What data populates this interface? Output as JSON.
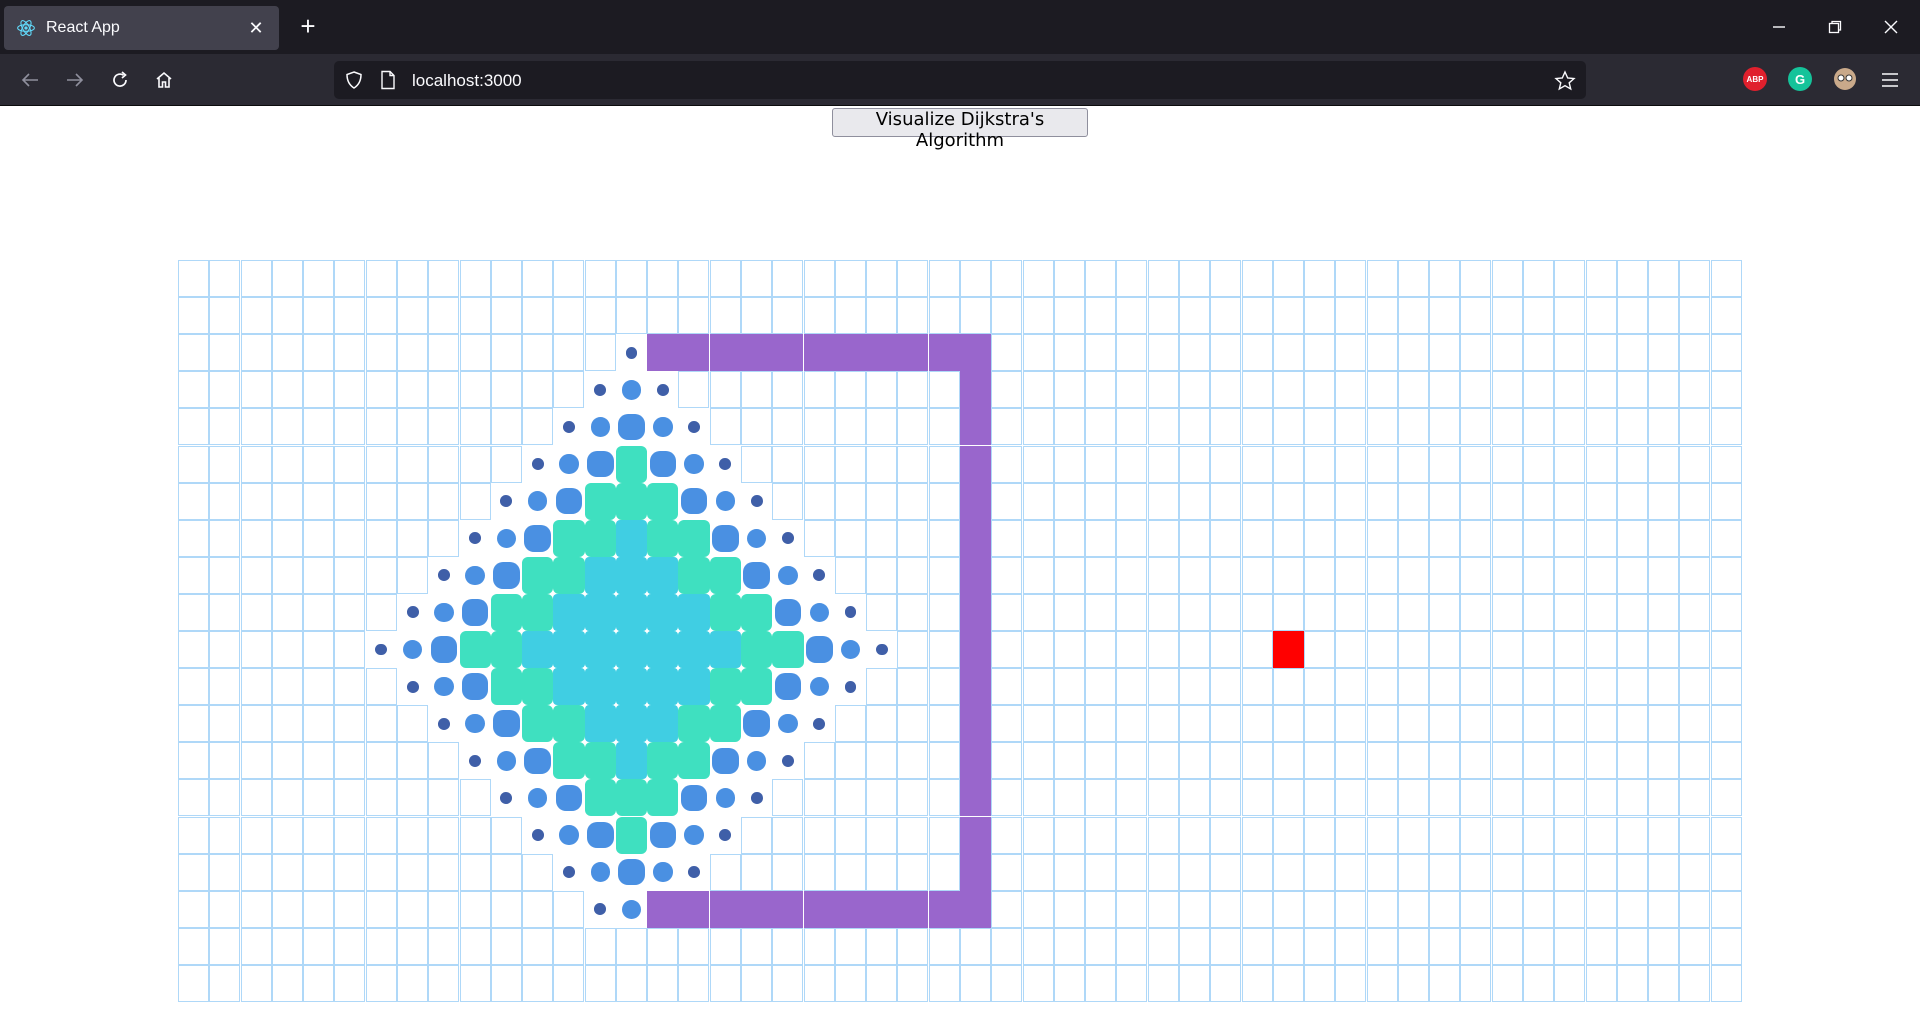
{
  "browser": {
    "tab_title": "React App",
    "tab_close_symbol": "✕",
    "new_tab_symbol": "+",
    "url": "localhost:3000",
    "extensions": [
      {
        "name": "abp-extension-icon",
        "label": "ABP",
        "color": "#e0202d"
      },
      {
        "name": "grammarly-extension-icon",
        "label": "G",
        "color": "#15c39a"
      },
      {
        "name": "avatar-extension-icon",
        "label": "",
        "color": "#c9a98a"
      }
    ]
  },
  "page": {
    "visualize_label": "Visualize Dijkstra's Algorithm"
  },
  "grid": {
    "rows": 20,
    "cols": 50,
    "start": {
      "row": 10,
      "col": 14
    },
    "target": {
      "row": 10,
      "col": 35
    },
    "walls": {
      "top": {
        "row": 2,
        "col_from": 15,
        "col_to": 25
      },
      "bottom": {
        "row": 17,
        "col_from": 15,
        "col_to": 25
      },
      "right": {
        "col": 25,
        "row_from": 2,
        "row_to": 17
      }
    },
    "colors": {
      "cell_border": "#afd8f8",
      "wall": "#9966cc",
      "target": "#ff0000",
      "visited_inner": "#40cee3",
      "visited_mid": "#3fe0c0",
      "visited_outer": "#4a90e2",
      "visited_edge": "#3f5fa8"
    }
  }
}
